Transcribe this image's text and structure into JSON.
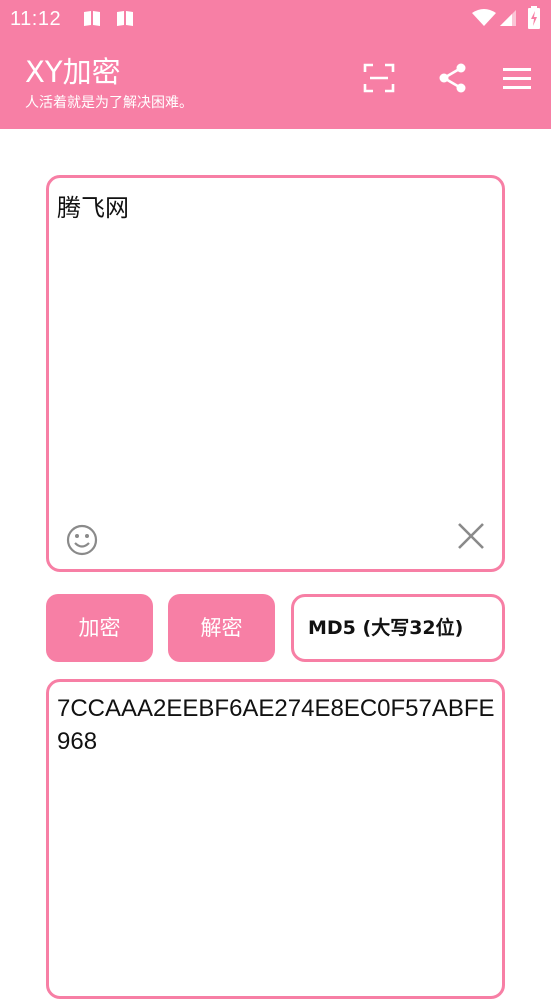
{
  "status_bar": {
    "time": "11:12",
    "icons": [
      "notification-book-icon",
      "notification-book-icon",
      "wifi-icon",
      "signal-icon",
      "battery-charging-icon"
    ]
  },
  "app_bar": {
    "title": "XY加密",
    "subtitle": "人活着就是为了解决困难。",
    "actions": [
      "scan-icon",
      "share-icon",
      "menu-icon"
    ]
  },
  "input": {
    "value": "腾飞网"
  },
  "actions": {
    "encrypt_label": "加密",
    "decrypt_label": "解密",
    "algorithm": "MD5 (大写32位)"
  },
  "output": {
    "value": "7CCAAA2EEBF6AE274E8EC0F57ABFE968"
  },
  "colors": {
    "accent": "#f77fa5",
    "background": "#ffffff",
    "text": "#111111",
    "icon_gray": "#8a8a8a"
  }
}
